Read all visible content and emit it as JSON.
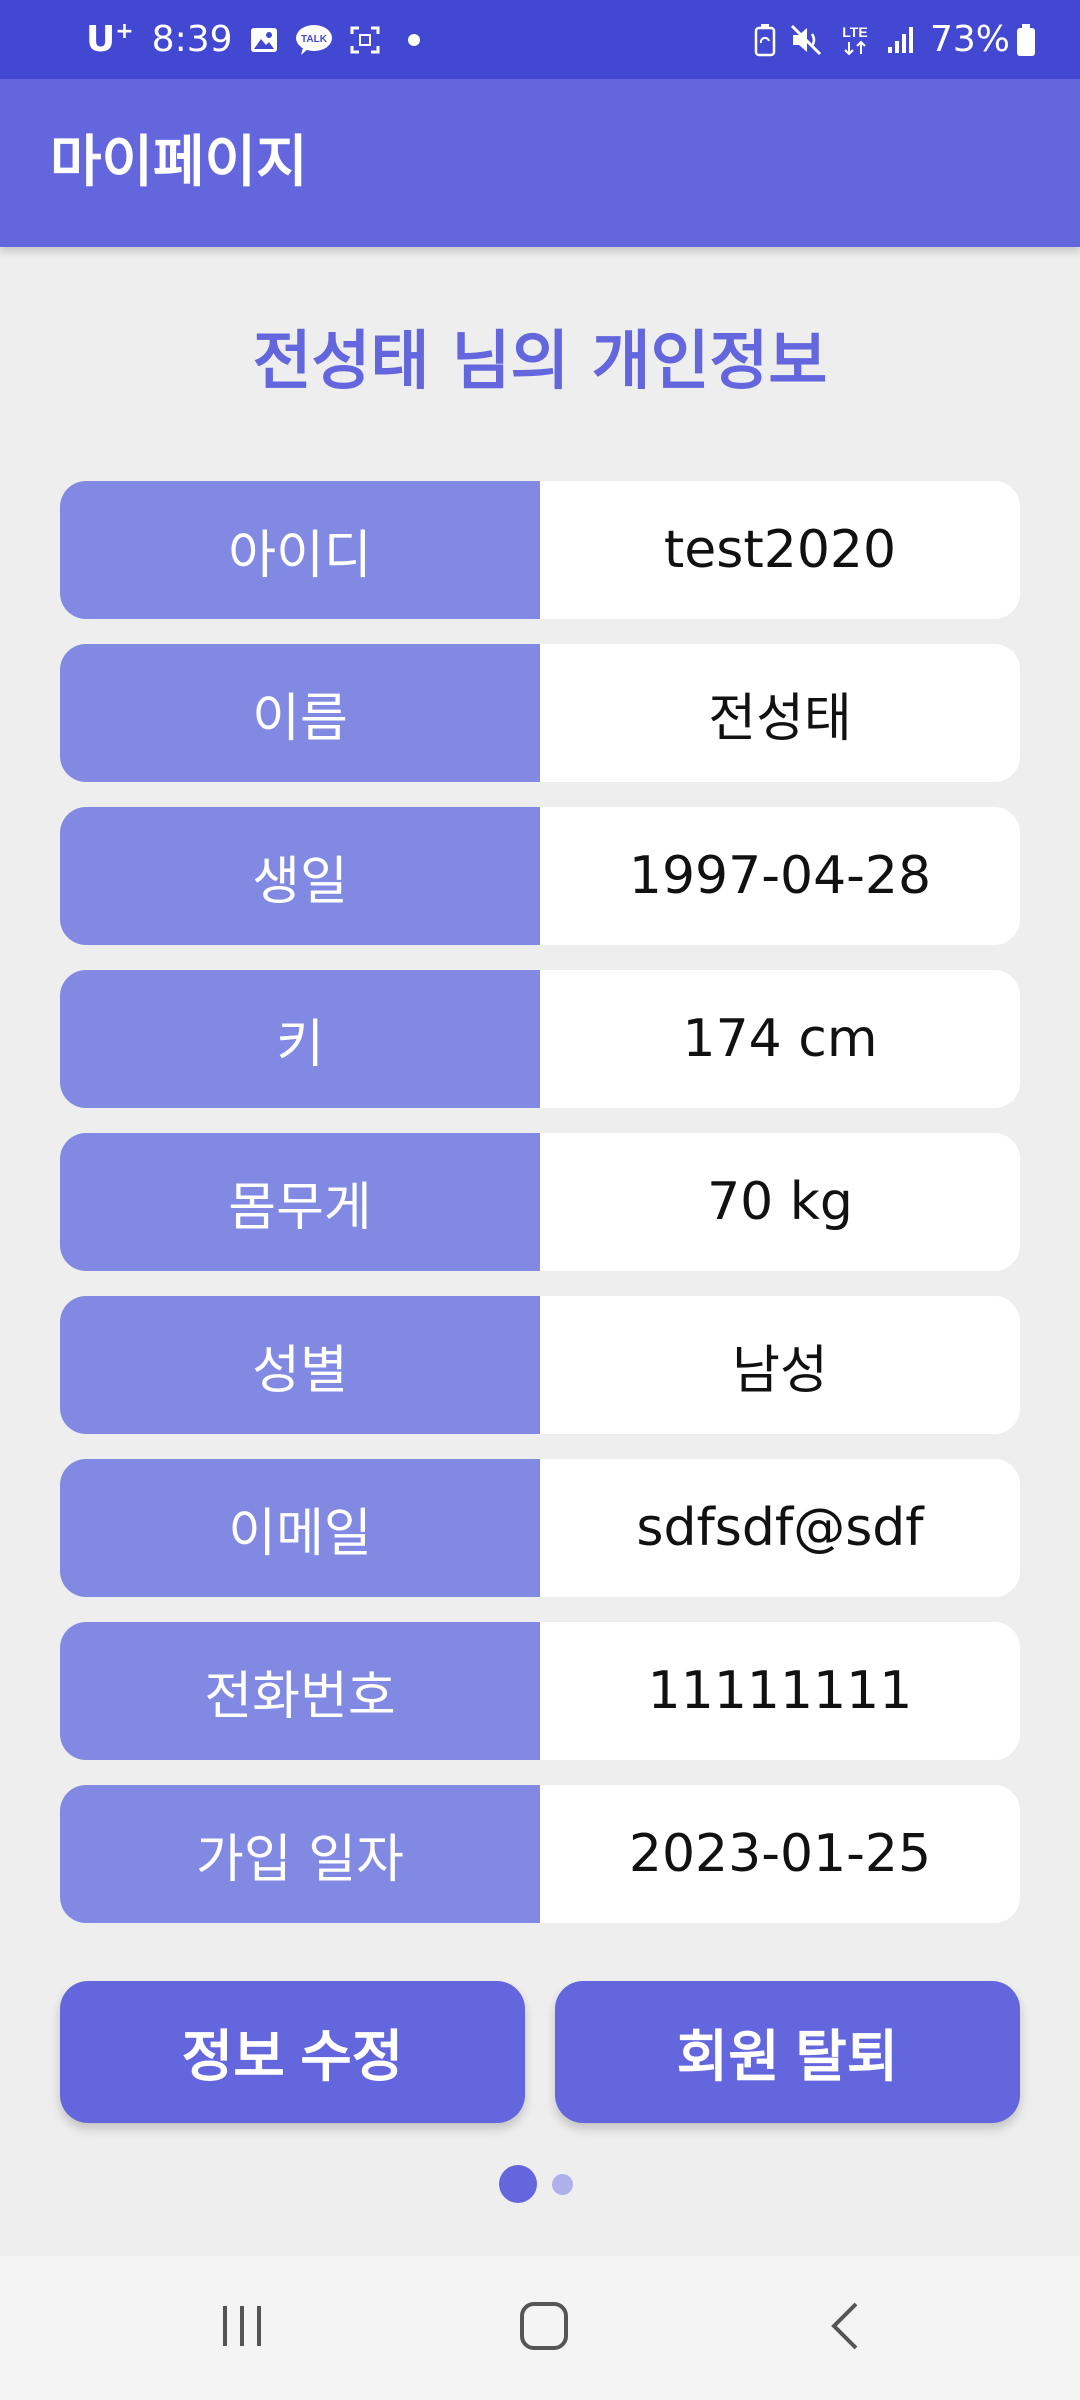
{
  "status_bar": {
    "carrier": "U",
    "carrier_sup": "+",
    "time": "8:39",
    "battery": "73%",
    "icons": [
      "gallery-icon",
      "kakaotalk-icon",
      "screenshot-icon",
      "dot-icon",
      "battery-saver-icon",
      "mute-icon",
      "lte-icon",
      "signal-icon",
      "battery-icon"
    ]
  },
  "app_bar": {
    "title": "마이페이지"
  },
  "info": {
    "title": "전성태 님의 개인정보",
    "rows": [
      {
        "label": "아이디",
        "value": "test2020"
      },
      {
        "label": "이름",
        "value": "전성태"
      },
      {
        "label": "생일",
        "value": "1997-04-28"
      },
      {
        "label": "키",
        "value": "174 cm"
      },
      {
        "label": "몸무게",
        "value": "70 kg"
      },
      {
        "label": "성별",
        "value": "남성"
      },
      {
        "label": "이메일",
        "value": "sdfsdf@sdf"
      },
      {
        "label": "전화번호",
        "value": "11111111"
      },
      {
        "label": "가입 일자",
        "value": "2023-01-25"
      }
    ]
  },
  "buttons": {
    "edit": "정보 수정",
    "withdraw": "회원 탈퇴"
  },
  "pager": {
    "pages": 2,
    "current": 1
  },
  "colors": {
    "status_bar": "#4348d3",
    "primary": "#6366dd",
    "label_bg": "#8189e3",
    "background": "#eeeeee"
  }
}
